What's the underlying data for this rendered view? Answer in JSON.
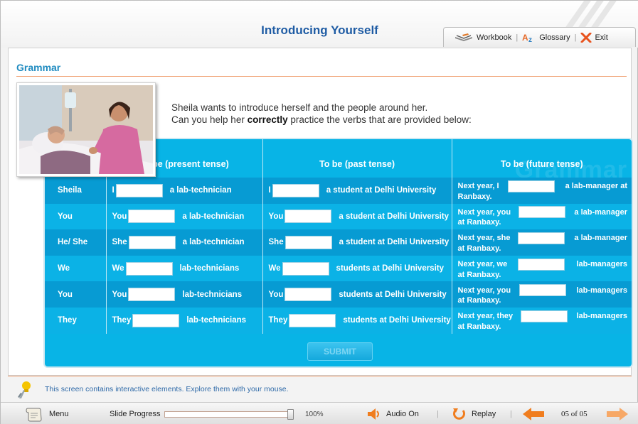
{
  "header": {
    "title": "Introducing Yourself",
    "toolbar": {
      "workbook": "Workbook",
      "glossary": "Glossary",
      "exit": "Exit",
      "separator": "|"
    }
  },
  "section": {
    "title": "Grammar"
  },
  "instructions": {
    "line1": "Sheila wants to introduce herself and the people around her.",
    "line2_pre": "Can you help her ",
    "line2_bold": "correctly",
    "line2_post": " practice the verbs that are provided below:"
  },
  "table": {
    "watermark": "Grammar",
    "headers": [
      "To be (present tense)",
      "To be (past tense)",
      "To be (future tense)"
    ],
    "rows": [
      {
        "subject": "Sheila",
        "present": [
          "I",
          "a lab-technician"
        ],
        "past": [
          "I",
          "a student at Delhi University"
        ],
        "future": [
          "Next year, I",
          "a lab-manager at",
          "Ranbaxy."
        ]
      },
      {
        "subject": "You",
        "present": [
          "You",
          "a lab-technician"
        ],
        "past": [
          "You",
          "a student at Delhi University"
        ],
        "future": [
          "Next year, you",
          "a lab-manager",
          "at Ranbaxy."
        ]
      },
      {
        "subject": "He/ She",
        "present": [
          "She",
          "a lab-technician"
        ],
        "past": [
          "She",
          "a student at Delhi University"
        ],
        "future": [
          "Next year, she",
          "a lab-manager",
          "at Ranbaxy."
        ]
      },
      {
        "subject": "We",
        "present": [
          "We",
          "lab-technicians"
        ],
        "past": [
          "We",
          "students at Delhi University"
        ],
        "future": [
          "Next year, we",
          "lab-managers",
          "at Ranbaxy."
        ]
      },
      {
        "subject": "You",
        "present": [
          "You",
          "lab-technicians"
        ],
        "past": [
          "You",
          "students at Delhi University"
        ],
        "future": [
          "Next year, you",
          "lab-managers",
          "at Ranbaxy."
        ]
      },
      {
        "subject": "They",
        "present": [
          "They",
          "lab-technicians"
        ],
        "past": [
          "They",
          "students at Delhi University"
        ],
        "future": [
          "Next year, they",
          "lab-managers",
          "at Ranbaxy."
        ]
      }
    ]
  },
  "submit_label": "SUBMIT",
  "notice": "This screen contains interactive elements. Explore them with your mouse.",
  "footer": {
    "menu": "Menu",
    "slide_progress_label": "Slide Progress",
    "progress_text": "100%",
    "progress_value": 1.0,
    "audio": "Audio On",
    "replay": "Replay",
    "page": "05 of 05"
  },
  "colors": {
    "title": "#1f5ca4",
    "section_title": "#1f8bc0",
    "table_bg": "#08b4e6",
    "row_dark": "#079bd3",
    "row_light": "#0bb2e6",
    "accent_arrow": "#f07d1e",
    "notice_text": "#2f6aa8"
  },
  "icons": [
    "workbook-icon",
    "glossary-icon",
    "exit-icon",
    "hint-icon",
    "menu-scroll-icon",
    "audio-icon",
    "replay-icon",
    "back-arrow-icon",
    "next-arrow-icon"
  ]
}
